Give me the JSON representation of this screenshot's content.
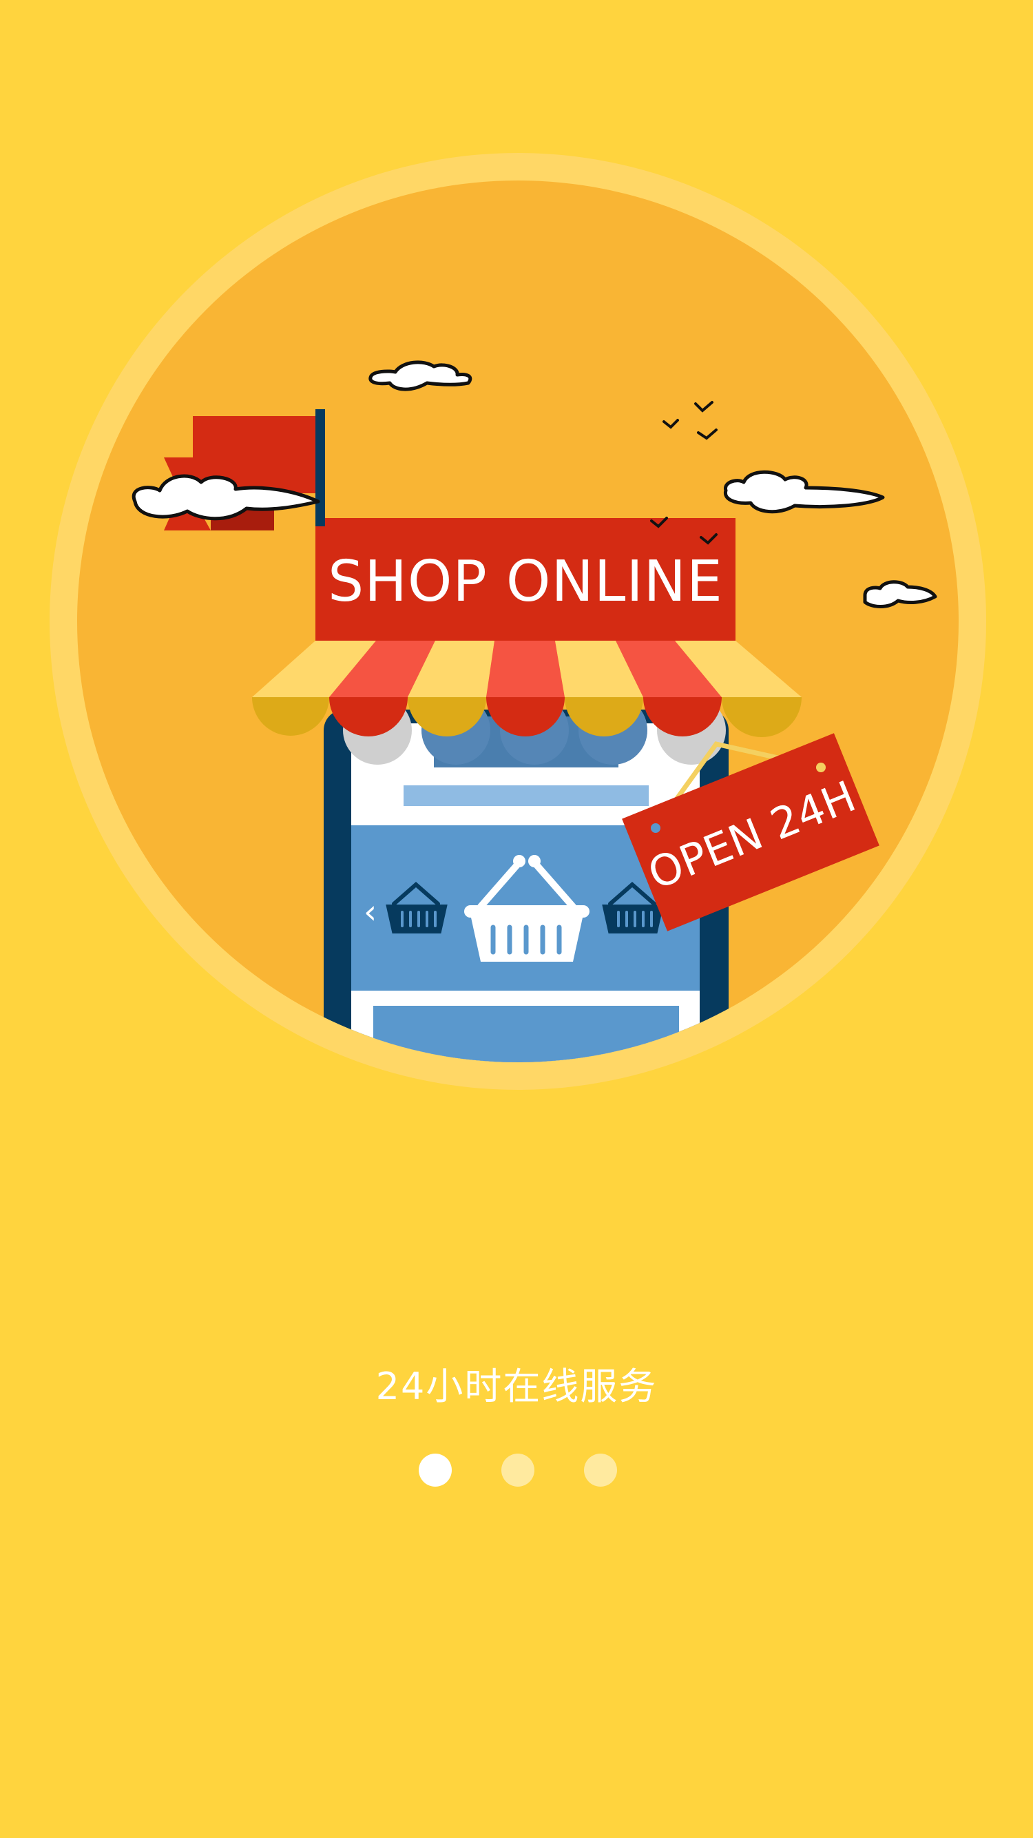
{
  "illustration": {
    "shop_sign": "SHOP ONLINE",
    "hanging_sign": "OPEN 24H",
    "prev_arrow": "‹"
  },
  "caption": "24小时在线服务",
  "pager": {
    "total": 3,
    "active_index": 0
  },
  "colors": {
    "background": "#FFD43E",
    "circle_ring": "#FFD766",
    "circle_fill": "#F9B534",
    "sign_red": "#D42B13",
    "awning_red": "#F55442",
    "awning_yellow": "#FFD86B",
    "phone_navy": "#063A5E",
    "screen_blue": "#5A98CD"
  }
}
